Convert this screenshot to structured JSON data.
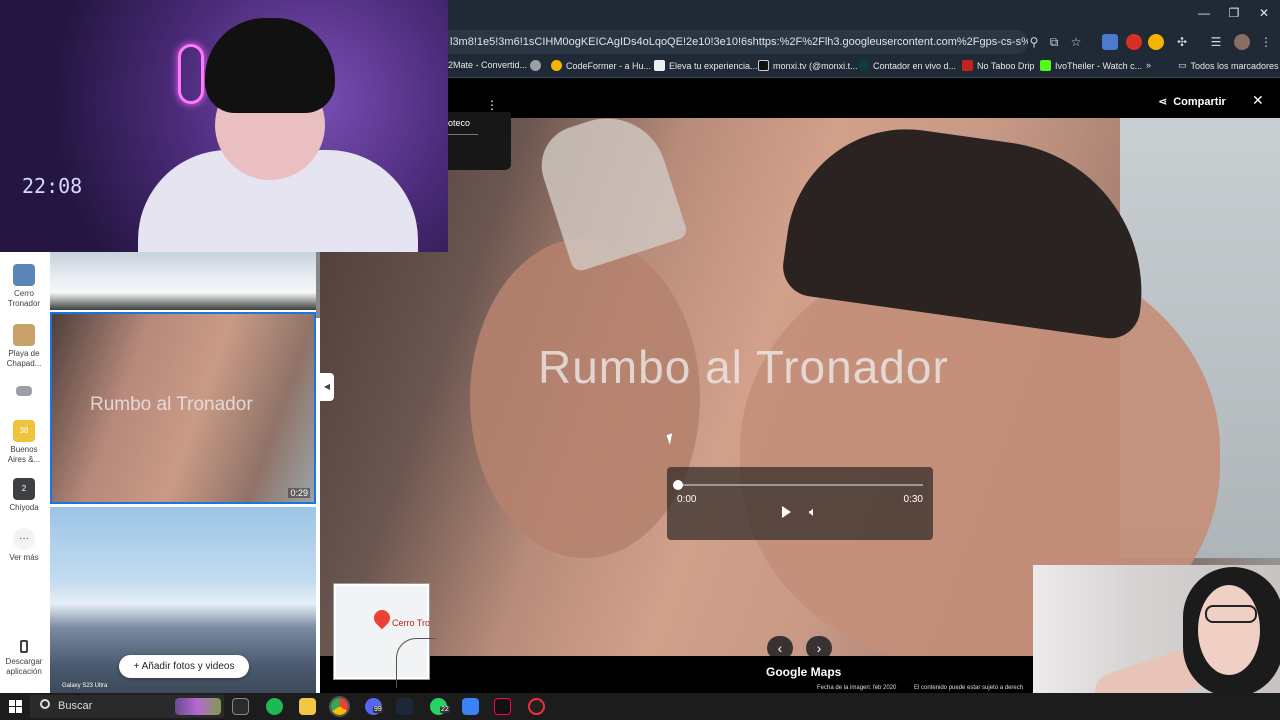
{
  "browser": {
    "url": "l3m8!1e5!3m6!1sCIHM0ogKEICAgIDs4oLqoQE!2e10!3e10!6shttps:%2F%2Flh3.googleusercontent.com%2Fgps-cs-s%2FAC9h4nrFfIAXSL1_...",
    "bookmarks": [
      "2Mate - Convertid...",
      "CodeFormer - a Hu...",
      "Eleva tu experiencia...",
      "monxi.tv (@monxi.t...",
      "Contador en vivo d...",
      "No Taboo Drip",
      "IvoTheiler - Watch c..."
    ],
    "more_bookmarks": "»",
    "all_bookmarks": "Todos los marcadores",
    "window_controls": [
      "—",
      "❐",
      "✕"
    ]
  },
  "viewer": {
    "share_label": "Compartir",
    "close_label": "✕",
    "kebab": "⋮",
    "mini_card_text": "oteco",
    "overlay_title": "Rumbo al Tronador",
    "controls": {
      "current": "0:00",
      "duration": "0:30",
      "progress": 0
    },
    "nav_prev": "‹",
    "nav_next": "›",
    "logo": "Google Maps",
    "date_text": "Fecha de la imagen: feb 2020",
    "rights_text": "El contenido puede estar sujeto a derech"
  },
  "rail": {
    "items": [
      {
        "label": "Cerro Tronador",
        "color": "#5a86b5"
      },
      {
        "label": "Playa de Chapad...",
        "color": "#c8a26a"
      },
      {
        "label": "",
        "color": "#9aa0a6"
      },
      {
        "label": "Buenos Aires &...",
        "color": "#f0c33c",
        "badge": "38"
      },
      {
        "label": "Chiyoda",
        "color": "#3c4043",
        "badge": "2"
      },
      {
        "label": "Ver más",
        "icon": "···"
      }
    ],
    "download_label": "Descargar aplicación"
  },
  "gallery": {
    "video_title": "Rumbo al Tronador",
    "video_duration": "0:29",
    "caption": "Galaxy S23 Ultra",
    "add_button": "Añadir fotos y videos"
  },
  "minimap": {
    "label": "Cerro Tro"
  },
  "webcam1": {
    "clock": "22:08"
  },
  "taskbar": {
    "search_placeholder": "Buscar",
    "whatsapp_badge": "22",
    "discord_badge": "99"
  }
}
